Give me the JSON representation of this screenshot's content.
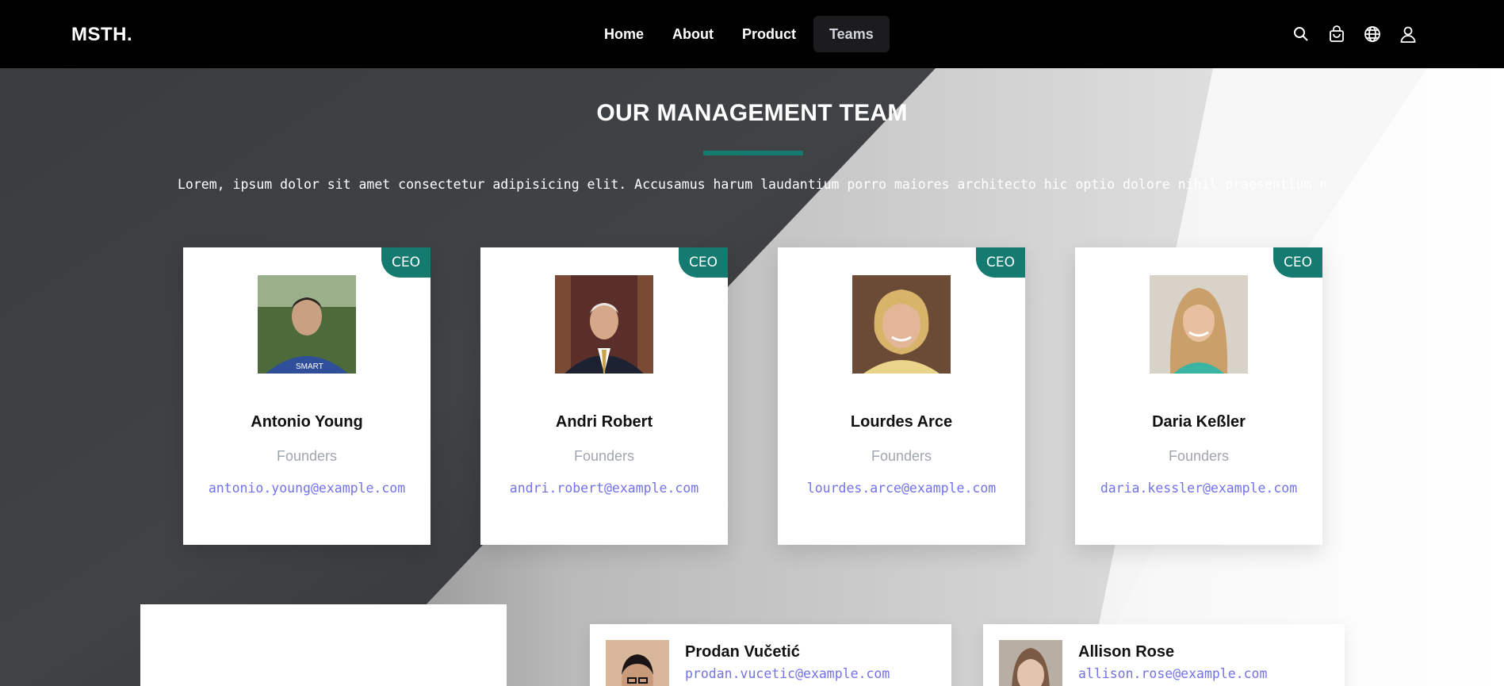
{
  "header": {
    "logo": "MSTH.",
    "nav": [
      "Home",
      "About",
      "Product",
      "Teams"
    ],
    "active_nav": "Teams",
    "icons": [
      "search-icon",
      "shopping-bag-icon",
      "globe-icon",
      "user-icon"
    ]
  },
  "section": {
    "title": "OUR MANAGEMENT TEAM",
    "intro": "Lorem, ipsum dolor sit amet consectetur adipisicing elit. Accusamus harum laudantium porro maiores architecto hic optio dolore nihil praesentium neque"
  },
  "team": [
    {
      "name": "Antonio Young",
      "role": "Founders",
      "email": "antonio.young@example.com",
      "badge": "CEO"
    },
    {
      "name": "Andri Robert",
      "role": "Founders",
      "email": "andri.robert@example.com",
      "badge": "CEO"
    },
    {
      "name": "Lourdes Arce",
      "role": "Founders",
      "email": "lourdes.arce@example.com",
      "badge": "CEO"
    },
    {
      "name": "Daria Keßler",
      "role": "Founders",
      "email": "daria.kessler@example.com",
      "badge": "CEO"
    }
  ],
  "members": [
    {
      "name": "Prodan Vučetić",
      "email": "prodan.vucetic@example.com"
    },
    {
      "name": "Allison Rose",
      "email": "allison.rose@example.com"
    }
  ],
  "colors": {
    "accent": "#157a70",
    "email": "#7272ea",
    "header_bg": "#000000"
  }
}
